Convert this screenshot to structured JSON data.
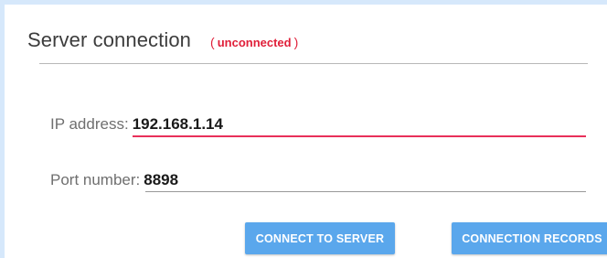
{
  "header": {
    "title": "Server connection",
    "status_open": "(",
    "status": "unconnected",
    "status_close": ")"
  },
  "form": {
    "ip": {
      "label": "IP address:",
      "value": "192.168.1.14"
    },
    "port": {
      "label": "Port number:",
      "value": "8898"
    }
  },
  "buttons": {
    "connect": "CONNECT TO SERVER",
    "records": "CONNECTION RECORDS"
  },
  "colors": {
    "accent": "#5aa7ec",
    "status_error": "#e0203a",
    "active_underline": "#e8305a"
  }
}
